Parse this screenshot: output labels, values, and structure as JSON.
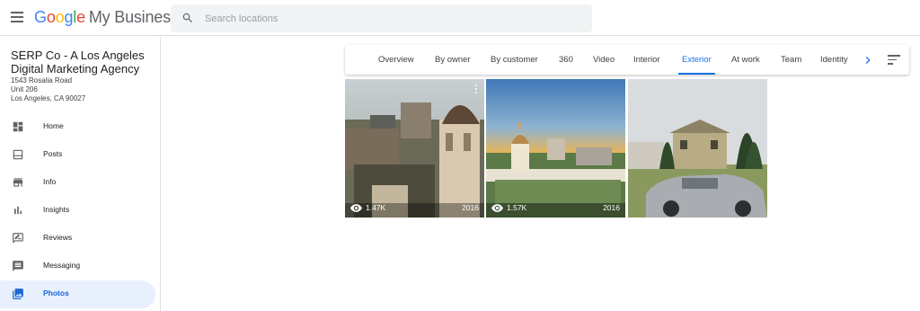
{
  "app": {
    "logo_google": "Google",
    "logo_product": "My Business"
  },
  "search": {
    "placeholder": "Search locations"
  },
  "business": {
    "name": "SERP Co - A Los Angeles Digital Marketing Agency",
    "address_line1": "1543 Rosalia Road",
    "address_line2": "Unit 206",
    "address_line3": "Los Angeles, CA 90027"
  },
  "sidebar": {
    "items": [
      {
        "label": "Home",
        "icon": "dashboard-icon"
      },
      {
        "label": "Posts",
        "icon": "posts-icon"
      },
      {
        "label": "Info",
        "icon": "storefront-icon"
      },
      {
        "label": "Insights",
        "icon": "bar-chart-icon"
      },
      {
        "label": "Reviews",
        "icon": "rate-review-icon"
      },
      {
        "label": "Messaging",
        "icon": "message-icon"
      },
      {
        "label": "Photos",
        "icon": "photo-library-icon",
        "active": true
      }
    ]
  },
  "tabs": [
    {
      "label": "Overview"
    },
    {
      "label": "By owner"
    },
    {
      "label": "By customer"
    },
    {
      "label": "360"
    },
    {
      "label": "Video"
    },
    {
      "label": "Interior"
    },
    {
      "label": "Exterior",
      "active": true
    },
    {
      "label": "At work"
    },
    {
      "label": "Team"
    },
    {
      "label": "Identity"
    }
  ],
  "photos": [
    {
      "views": "1.47K",
      "year": "2016"
    },
    {
      "views": "1.57K",
      "year": "2016"
    },
    {
      "views": "",
      "year": ""
    }
  ],
  "colors": {
    "accent": "#1a73e8",
    "active_bg": "#e8f0fe"
  }
}
